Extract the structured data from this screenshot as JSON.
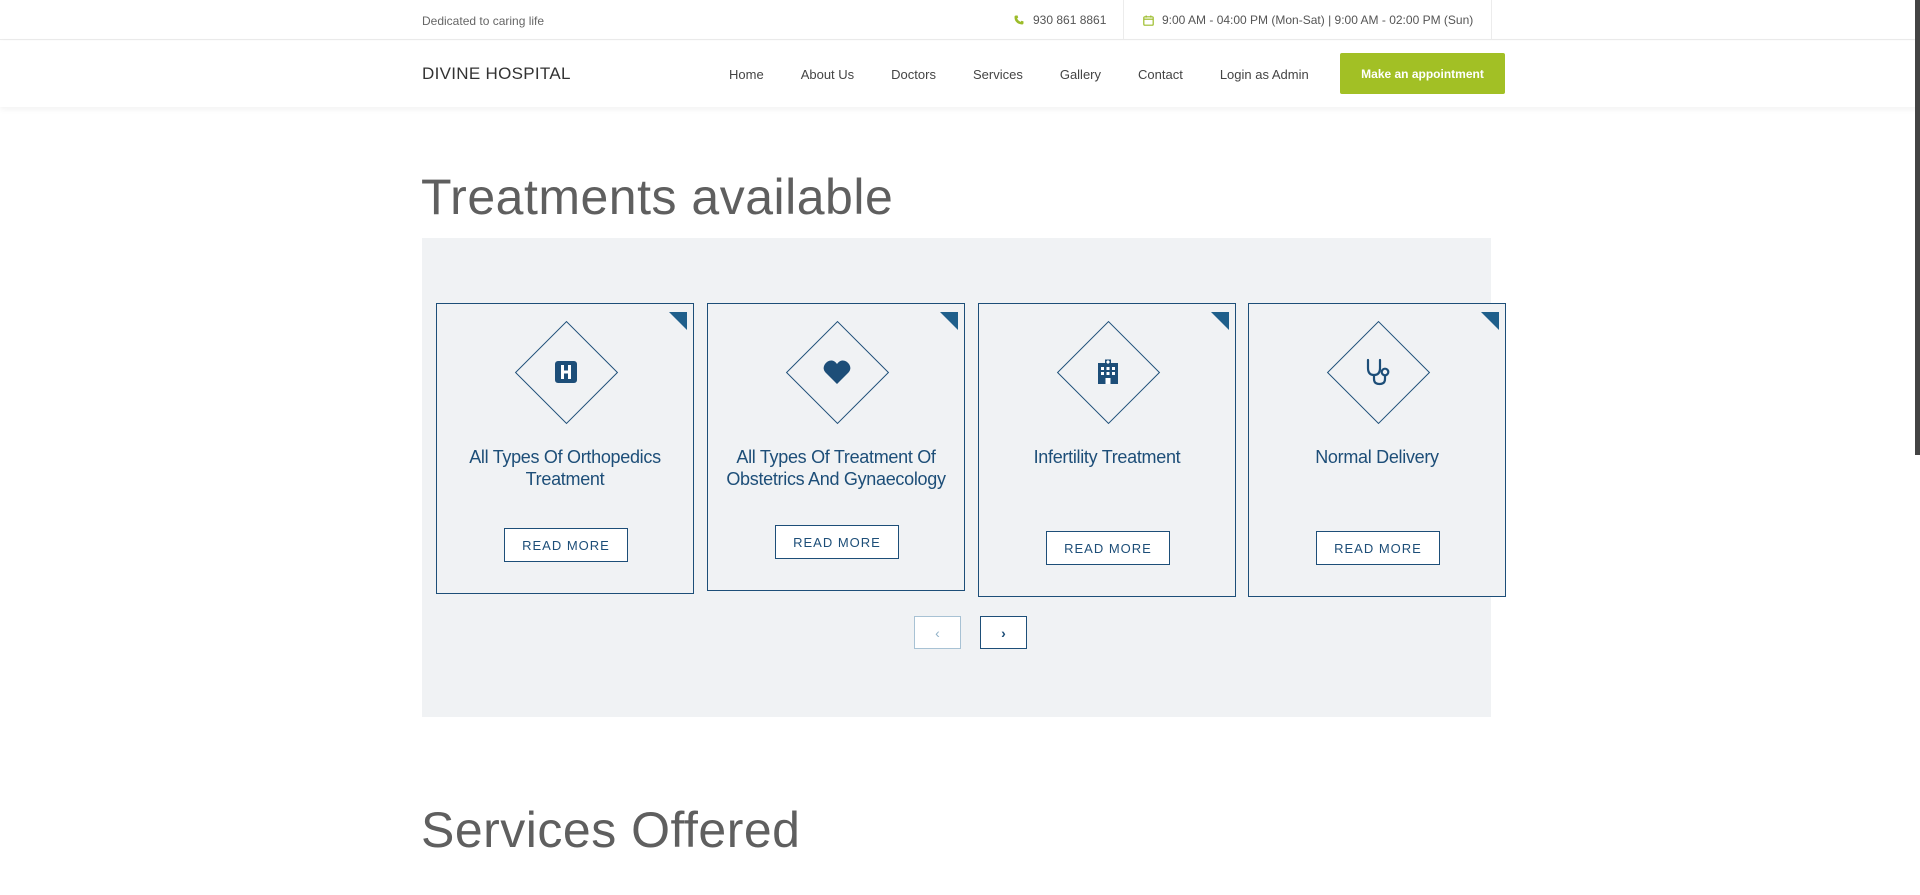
{
  "topbar": {
    "tagline": "Dedicated to caring life",
    "phone": "930 861 8861",
    "hours": "9:00 AM - 04:00 PM (Mon-Sat) | 9:00 AM - 02:00 PM (Sun)",
    "icons": [
      "phone-icon",
      "calendar-icon"
    ]
  },
  "header": {
    "brand": "DIVINE HOSPITAL",
    "nav": [
      "Home",
      "About Us",
      "Doctors",
      "Services",
      "Gallery",
      "Contact",
      "Login as Admin"
    ],
    "cta": "Make an appointment",
    "cta_color": "#a2c025"
  },
  "treatments": {
    "title": "Treatments available",
    "cards": [
      {
        "title": "All Types Of Orthopedics Treatment",
        "icon": "hospital-h-icon",
        "button": "READ MORE"
      },
      {
        "title": "All Types Of Treatment Of Obstetrics And Gynaecology",
        "icon": "heart-icon",
        "button": "READ MORE"
      },
      {
        "title": "Infertility Treatment",
        "icon": "hospital-building-icon",
        "button": "READ MORE"
      },
      {
        "title": "Normal Delivery",
        "icon": "stethoscope-icon",
        "button": "READ MORE"
      }
    ],
    "pager": {
      "prev": "‹",
      "next": "›"
    },
    "accent_color": "#1d4e78"
  },
  "services": {
    "title": "Services Offered"
  }
}
